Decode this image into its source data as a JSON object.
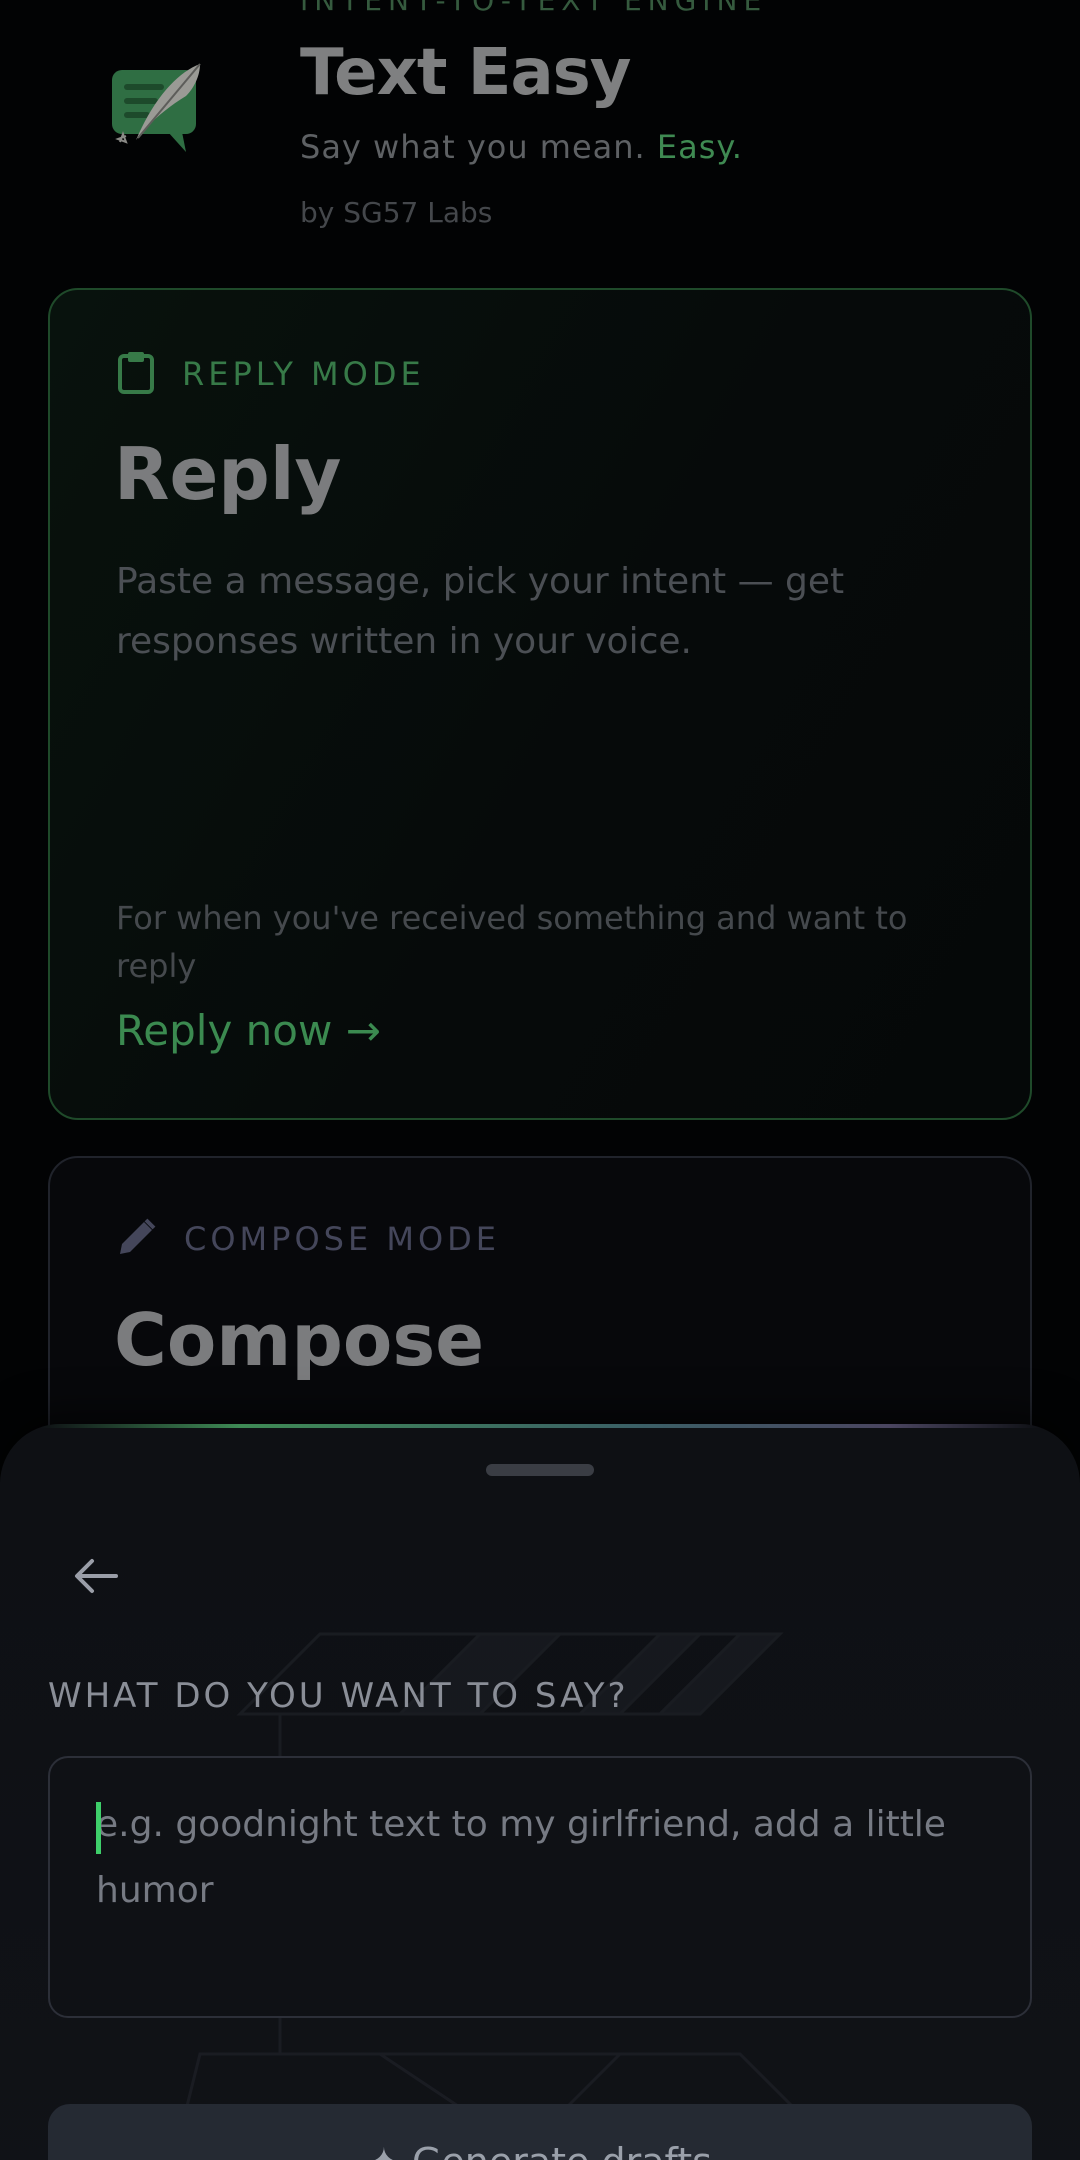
{
  "header": {
    "eyebrow": "INTENT-TO-TEXT ENGINE",
    "title": "Text Easy",
    "tagline_main": "Say what you mean. ",
    "tagline_accent": "Easy.",
    "byline": "by SG57 Labs",
    "logo_icon": "quill-chat-icon"
  },
  "reply_card": {
    "mode_icon": "clipboard-icon",
    "mode_label": "REPLY MODE",
    "title": "Reply",
    "description": "Paste a message, pick your intent — get responses written in your voice.",
    "footnote": "For when you've received something and want to reply",
    "cta": "Reply now →"
  },
  "compose_card": {
    "mode_icon": "pencil-icon",
    "mode_label": "COMPOSE MODE",
    "title": "Compose"
  },
  "sheet": {
    "back_icon": "arrow-left-icon",
    "prompt_label": "WHAT DO YOU WANT TO SAY?",
    "input_value": "",
    "input_placeholder": "e.g. goodnight text to my girlfriend, add a little humor",
    "generate_label": "✦ Generate drafts"
  },
  "colors": {
    "background": "#020304",
    "accent_green": "#3ecf6a",
    "sheet_bg": "#0e1014",
    "input_border": "#2c2f38"
  }
}
